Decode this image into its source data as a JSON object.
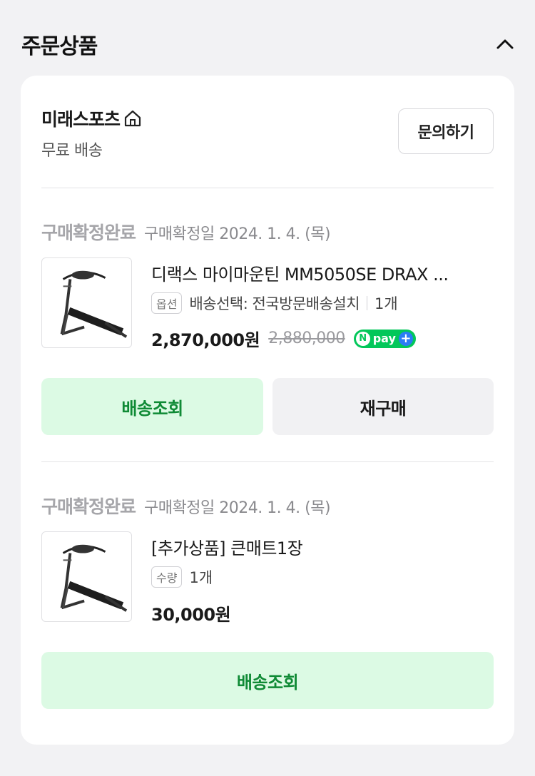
{
  "section": {
    "title": "주문상품",
    "collapse_icon": "chevron-up-icon"
  },
  "seller": {
    "name": "미래스포츠",
    "home_icon": "home-icon",
    "shipping": "무료 배송",
    "inquiry_label": "문의하기"
  },
  "orders": [
    {
      "status": "구매확정완료",
      "confirm_date": "구매확정일 2024. 1. 4. (목)",
      "product_name": "디랙스 마이마운틴 MM5050SE DRAX ...",
      "option_tag": "옵션",
      "option_text": "배송선택: 전국방문배송설치",
      "quantity": "1개",
      "price": "2,870,000원",
      "original_price": "2,880,000",
      "npay": {
        "n": "N",
        "word": "pay",
        "plus": "+"
      },
      "track_label": "배송조회",
      "rebuy_label": "재구매"
    },
    {
      "status": "구매확정완료",
      "confirm_date": "구매확정일 2024. 1. 4. (목)",
      "product_name": "[추가상품] 큰매트1장",
      "option_tag": "수량",
      "quantity": "1개",
      "price": "30,000원",
      "track_label": "배송조회"
    }
  ],
  "colors": {
    "green_text": "#0f8a35",
    "green_bg": "#dcfae4",
    "npay_green": "#03c75a",
    "npay_plus_blue": "#2a7cf4"
  }
}
